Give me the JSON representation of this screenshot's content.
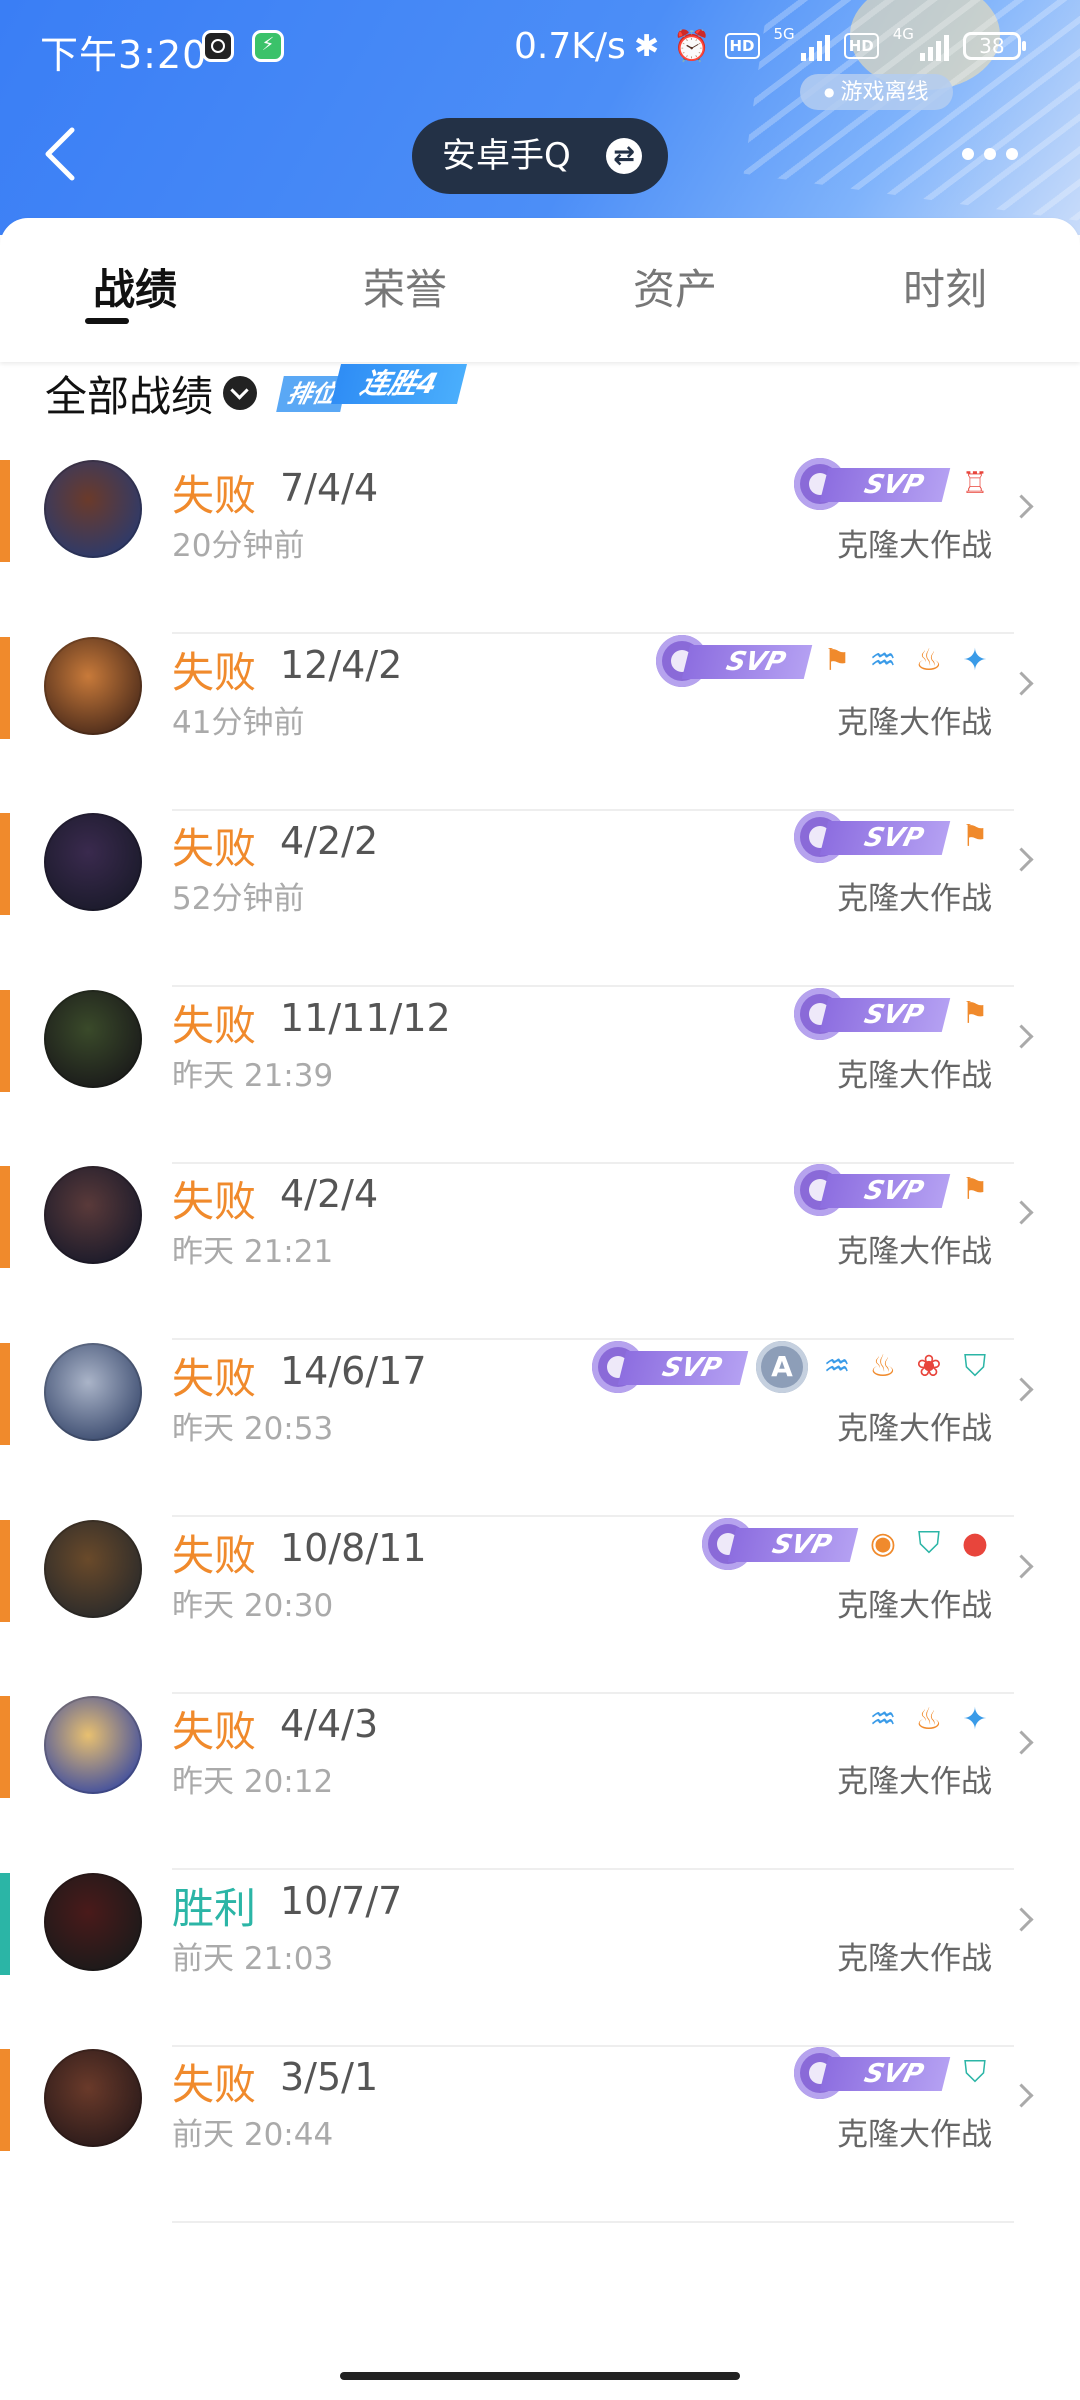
{
  "status_bar": {
    "time": "下午3:20",
    "speed": "0.7K/s",
    "battery": "38",
    "network_1": "5G",
    "network_2": "4G",
    "hd_label": "HD"
  },
  "header": {
    "offline_label": "游戏离线",
    "account_label": "安卓手Q",
    "swap_icon": "⇄"
  },
  "tabs": [
    {
      "label": "战绩",
      "active": true
    },
    {
      "label": "荣誉",
      "active": false
    },
    {
      "label": "资产",
      "active": false
    },
    {
      "label": "时刻",
      "active": false
    }
  ],
  "filter": {
    "label": "全部战绩",
    "streak_prefix": "排位",
    "streak_label": "连胜4"
  },
  "svp_label": "SVP",
  "mvp_letter": "A",
  "colors": {
    "loss": "#f08a2c",
    "win": "#2bb5a6",
    "svp_purple": "#8d6ee0",
    "header_blue": "#3a7ef5"
  },
  "matches": [
    {
      "result": "失败",
      "kda": "7/4/4",
      "time": "20分钟前",
      "mode": "克隆大作战",
      "win": false,
      "svp": true,
      "icons": [
        "crest-icon"
      ]
    },
    {
      "result": "失败",
      "kda": "12/4/2",
      "time": "41分钟前",
      "mode": "克隆大作战",
      "win": false,
      "svp": true,
      "icons": [
        "flag-icon",
        "wave-icon",
        "flame-icon",
        "wings-icon"
      ]
    },
    {
      "result": "失败",
      "kda": "4/2/2",
      "time": "52分钟前",
      "mode": "克隆大作战",
      "win": false,
      "svp": true,
      "icons": [
        "flag-icon"
      ]
    },
    {
      "result": "失败",
      "kda": "11/11/12",
      "time": "昨天 21:39",
      "mode": "克隆大作战",
      "win": false,
      "svp": true,
      "icons": [
        "flag-icon"
      ]
    },
    {
      "result": "失败",
      "kda": "4/2/4",
      "time": "昨天 21:21",
      "mode": "克隆大作战",
      "win": false,
      "svp": true,
      "icons": [
        "flag-icon"
      ]
    },
    {
      "result": "失败",
      "kda": "14/6/17",
      "time": "昨天 20:53",
      "mode": "克隆大作战",
      "win": false,
      "svp": true,
      "icons": [
        "mvp-a-icon",
        "wave-icon",
        "flame-icon",
        "lotus-icon",
        "shield-icon"
      ]
    },
    {
      "result": "失败",
      "kda": "10/8/11",
      "time": "昨天 20:30",
      "mode": "克隆大作战",
      "win": false,
      "svp": true,
      "icons": [
        "coins-icon",
        "shield-icon",
        "blood-icon"
      ]
    },
    {
      "result": "失败",
      "kda": "4/4/3",
      "time": "昨天 20:12",
      "mode": "克隆大作战",
      "win": false,
      "svp": false,
      "icons": [
        "wave-icon",
        "flame-icon",
        "wings-icon"
      ]
    },
    {
      "result": "胜利",
      "kda": "10/7/7",
      "time": "前天 21:03",
      "mode": "克隆大作战",
      "win": true,
      "svp": false,
      "icons": []
    },
    {
      "result": "失败",
      "kda": "3/5/1",
      "time": "前天 20:44",
      "mode": "克隆大作战",
      "win": false,
      "svp": true,
      "icons": [
        "shield-icon"
      ]
    }
  ]
}
